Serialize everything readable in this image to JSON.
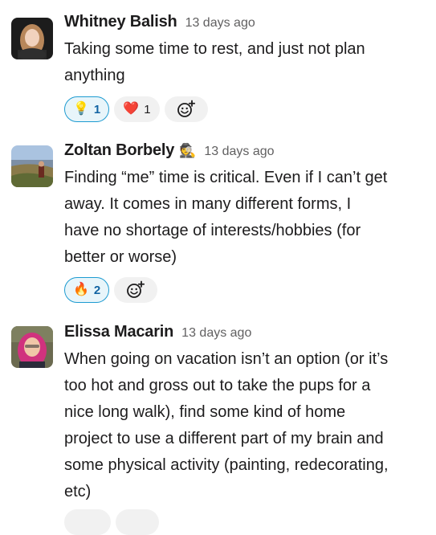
{
  "messages": [
    {
      "author": "Whitney Balish",
      "status_emoji": "",
      "time": "13 days ago",
      "lines": [
        "Taking some time to rest, and just not plan",
        "anything"
      ],
      "reactions": [
        {
          "emoji": "💡",
          "count": "1",
          "mine": true
        },
        {
          "emoji": "❤️",
          "count": "1",
          "mine": false
        }
      ]
    },
    {
      "author": "Zoltan Borbely",
      "status_emoji": "🕵️",
      "time": "13 days ago",
      "lines": [
        "Finding “me” time is critical.  Even if I can’t get",
        "away.  It comes in many different forms, I",
        "have no shortage of interests/hobbies (for",
        "better or worse)"
      ],
      "reactions": [
        {
          "emoji": "🔥",
          "count": "2",
          "mine": true
        }
      ]
    },
    {
      "author": "Elissa Macarin",
      "status_emoji": "",
      "time": "13 days ago",
      "lines": [
        "When going on vacation isn’t an option (or it’s",
        "too hot and gross out to take the pups for a",
        "nice long walk), find some kind of home",
        "project to use a different part of my brain and",
        "some physical activity (painting, redecorating,",
        "etc)"
      ],
      "reactions": []
    }
  ],
  "colors": {
    "accent_blue": "#1d9bd1",
    "reaction_bg": "#f1f1f1",
    "text": "#1d1c1d",
    "muted": "#616061"
  }
}
